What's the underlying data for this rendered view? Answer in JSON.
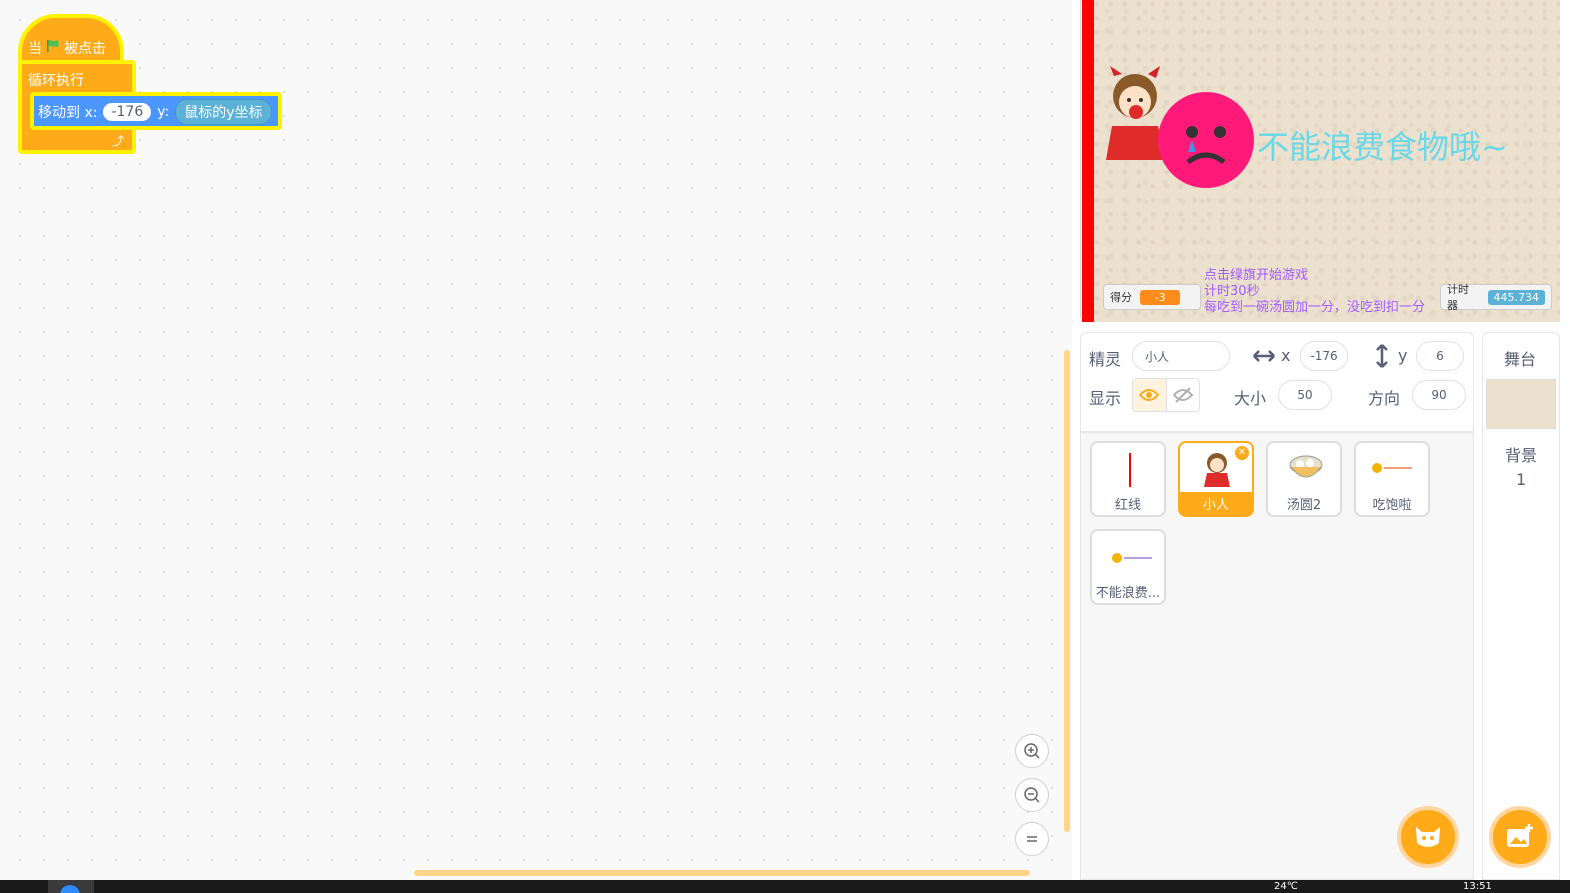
{
  "script": {
    "hat_when": "当",
    "hat_clicked": "被点击",
    "loop_label": "循环执行",
    "motion_label": "移动到 x:",
    "motion_x": "-176",
    "motion_y_label": "y:",
    "motion_y_reporter": "鼠标的y坐标"
  },
  "stage": {
    "message": "不能浪费食物哦~",
    "score_label": "得分",
    "score_value": "-3",
    "timer_label": "计时器",
    "timer_value": "445.734",
    "instructions": [
      "点击绿旗开始游戏",
      "计时30秒",
      "每吃到一碗汤圆加一分，没吃到扣一分"
    ]
  },
  "sprite_info": {
    "sprite_label": "精灵",
    "sprite_name": "小人",
    "x_label": "x",
    "x_value": "-176",
    "y_label": "y",
    "y_value": "6",
    "show_label": "显示",
    "size_label": "大小",
    "size_value": "50",
    "direction_label": "方向",
    "direction_value": "90"
  },
  "sprites": [
    {
      "name": "红线"
    },
    {
      "name": "小人"
    },
    {
      "name": "汤圆2"
    },
    {
      "name": "吃饱啦"
    },
    {
      "name": "不能浪费..."
    }
  ],
  "stage_panel": {
    "title": "舞台",
    "backdrop_label": "背景",
    "backdrop_count": "1"
  },
  "taskbar": {
    "temperature": "24℃",
    "time": "13:51"
  },
  "colors": {
    "events": "#ffab19",
    "motion": "#4c97ff",
    "highlight": "#fff200",
    "score_monitor": "#ff8c1a",
    "timer_monitor": "#5cb1d6"
  }
}
